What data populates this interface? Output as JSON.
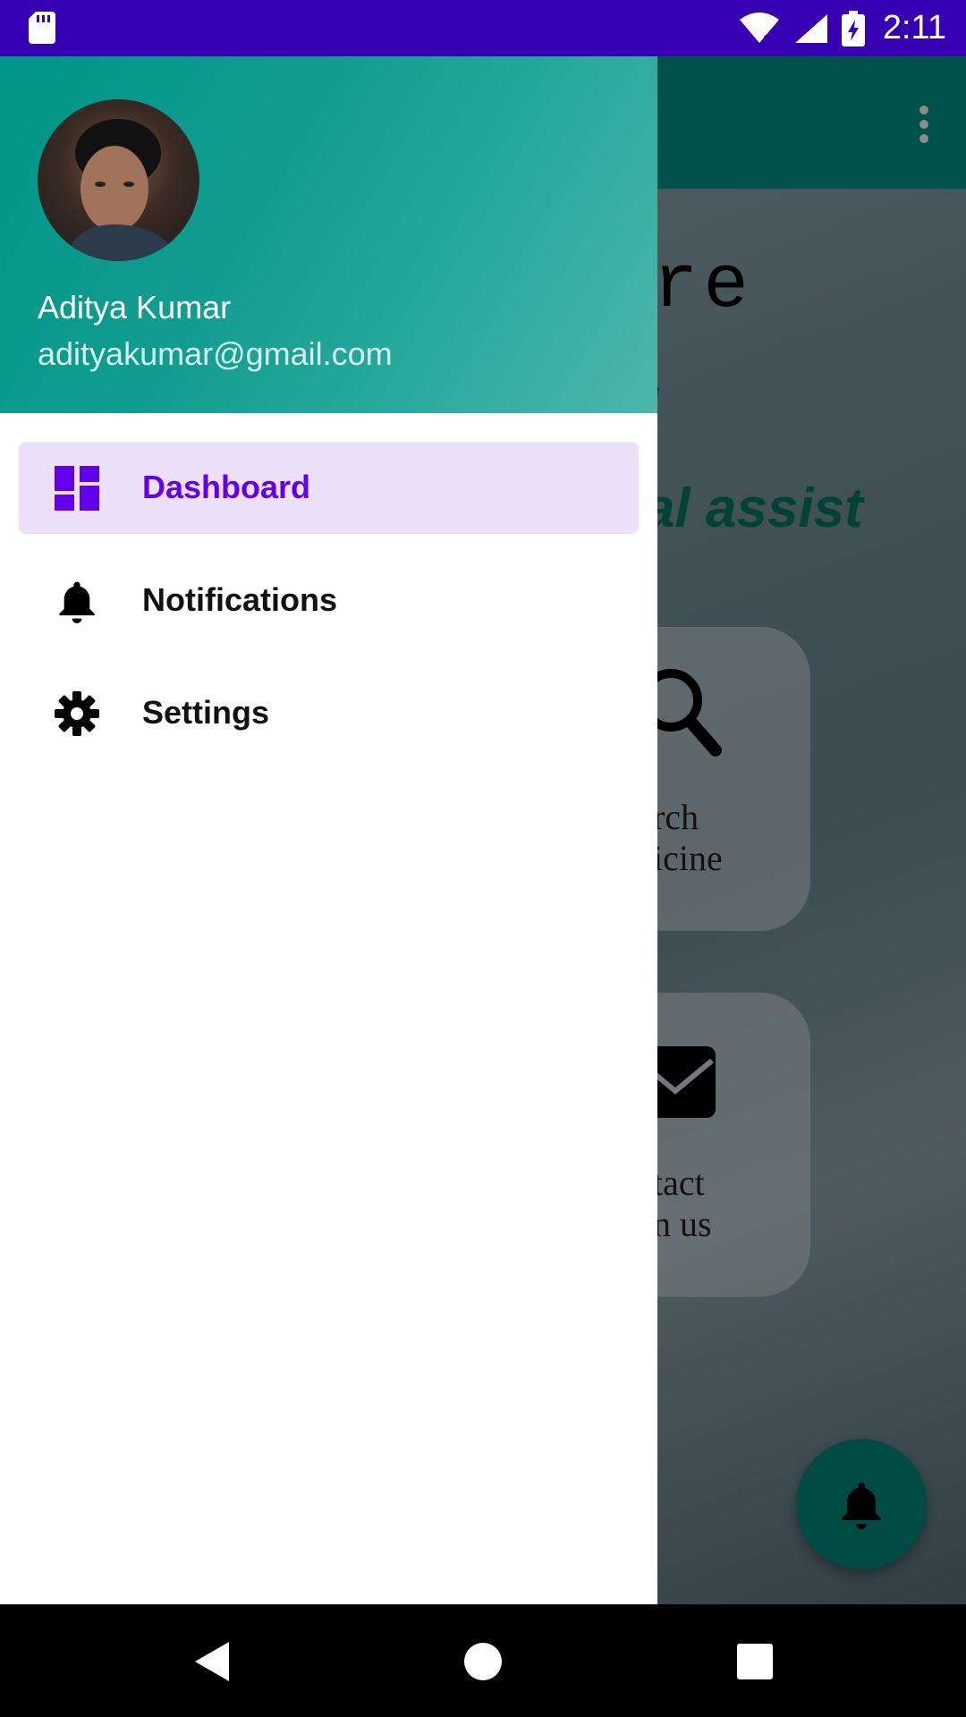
{
  "status_bar": {
    "time": "2:11",
    "icons": [
      "sd-card-icon",
      "wifi-icon",
      "signal-icon",
      "battery-charging-icon"
    ]
  },
  "background_app": {
    "title_fragment": "re",
    "subtitle_fragment_1": "l",
    "subtitle_fragment_2": "al assist",
    "cards": [
      {
        "icon": "search-icon",
        "line1": "rch",
        "line2": "icine"
      },
      {
        "icon": "mail-icon",
        "line1": "tact",
        "line2": "n us"
      }
    ],
    "fab_icon": "bell-icon",
    "more_icon": "more-vert-icon"
  },
  "drawer": {
    "user": {
      "name": "Aditya Kumar",
      "email": "adityakumar@gmail.com"
    },
    "menu": [
      {
        "label": "Dashboard",
        "icon": "dashboard-icon",
        "active": true
      },
      {
        "label": "Notifications",
        "icon": "bell-icon",
        "active": false
      },
      {
        "label": "Settings",
        "icon": "gear-icon",
        "active": false
      }
    ]
  },
  "colors": {
    "status_bar": "#3700b3",
    "primary": "#009688",
    "accent": "#6200ee",
    "active_item_bg": "#ede0fb"
  },
  "nav_bar": {
    "icons": [
      "back-icon",
      "home-icon",
      "recents-icon"
    ]
  }
}
